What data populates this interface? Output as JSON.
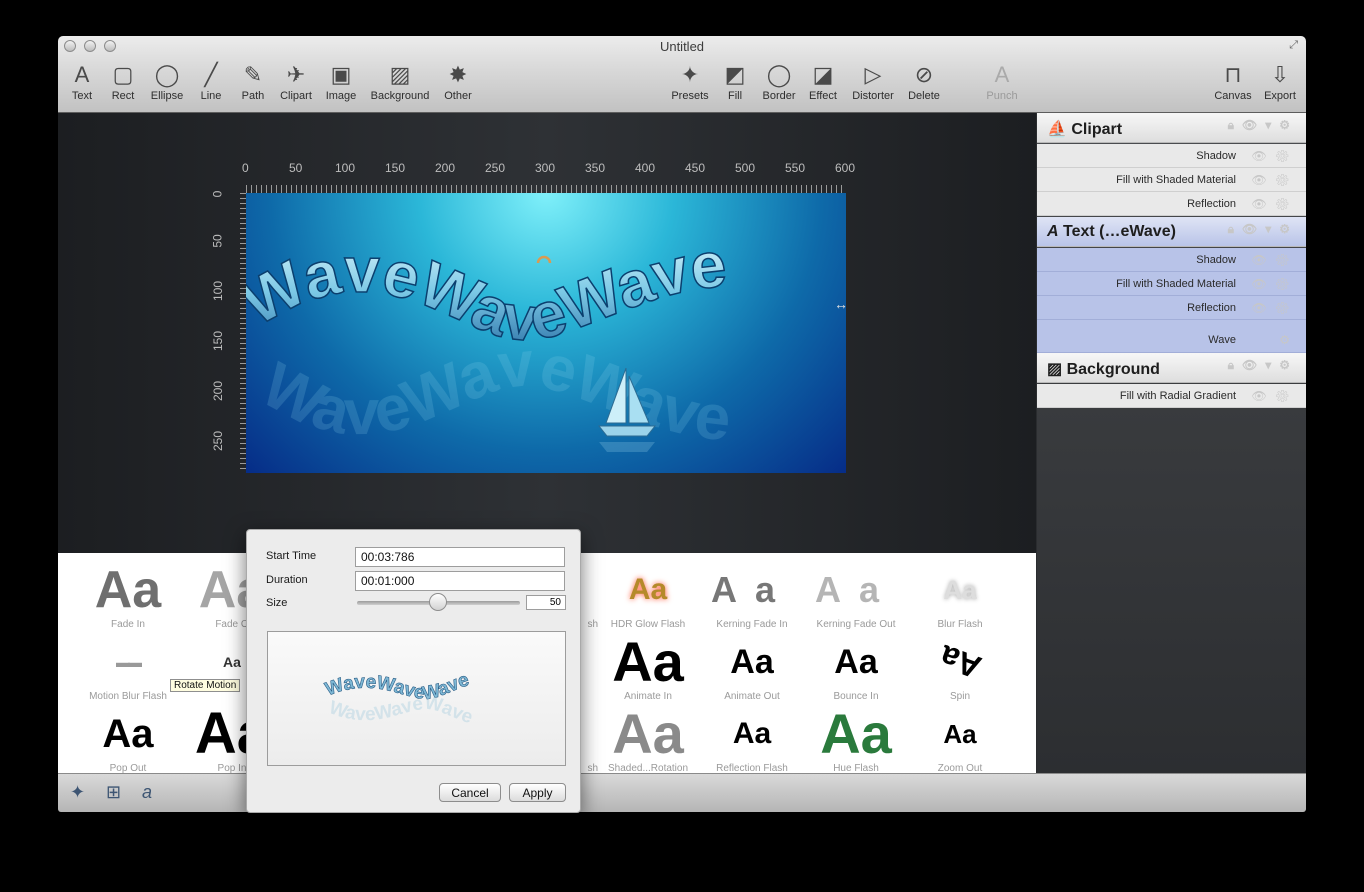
{
  "window": {
    "title": "Untitled"
  },
  "toolbar": {
    "left": [
      {
        "label": "Text",
        "icon": "A"
      },
      {
        "label": "Rect",
        "icon": "▢"
      },
      {
        "label": "Ellipse",
        "icon": "◯"
      },
      {
        "label": "Line",
        "icon": "╱"
      },
      {
        "label": "Path",
        "icon": "✎"
      },
      {
        "label": "Clipart",
        "icon": "✈"
      },
      {
        "label": "Image",
        "icon": "▣"
      },
      {
        "label": "Background",
        "icon": "▨"
      },
      {
        "label": "Other",
        "icon": "✸"
      }
    ],
    "middle": [
      {
        "label": "Presets",
        "icon": "✦"
      },
      {
        "label": "Fill",
        "icon": "◩"
      },
      {
        "label": "Border",
        "icon": "◯"
      },
      {
        "label": "Effect",
        "icon": "◪"
      },
      {
        "label": "Distorter",
        "icon": "▷"
      },
      {
        "label": "Delete",
        "icon": "⊘"
      }
    ],
    "punch": {
      "label": "Punch",
      "icon": "A"
    },
    "right": [
      {
        "label": "Canvas",
        "icon": "⊓"
      },
      {
        "label": "Export",
        "icon": "⇩"
      }
    ]
  },
  "ruler": {
    "x": [
      "0",
      "50",
      "100",
      "150",
      "200",
      "250",
      "300",
      "350",
      "400",
      "450",
      "500",
      "550",
      "600"
    ],
    "y": [
      "0",
      "50",
      "100",
      "150",
      "200",
      "250"
    ]
  },
  "artwork": {
    "text": "WaveWaveWave"
  },
  "layers": [
    {
      "name": "Clipart",
      "icon": "⛵",
      "selected": false,
      "effects": [
        "Shadow",
        "Fill with Shaded Material",
        "Reflection"
      ]
    },
    {
      "name": "Text (…eWave)",
      "icon": "A",
      "selected": true,
      "effects": [
        "Shadow",
        "Fill with Shaded Material",
        "Reflection",
        "Wave"
      ]
    },
    {
      "name": "Background",
      "icon": "▨",
      "selected": false,
      "effects": [
        "Fill with Radial Gradient"
      ]
    }
  ],
  "presets": {
    "sample": "Aa",
    "visible": [
      {
        "label": "Fade In"
      },
      {
        "label": "Fade O"
      },
      {
        "label": "HDR Glow Flash"
      },
      {
        "label": "Kerning Fade In"
      },
      {
        "label": "Kerning Fade Out"
      },
      {
        "label": "Blur Flash"
      },
      {
        "label": "Motion Blur Flash"
      },
      {
        "label": "Animate In"
      },
      {
        "label": "Animate Out"
      },
      {
        "label": "Bounce In"
      },
      {
        "label": "Spin"
      },
      {
        "label": "Pop Out"
      },
      {
        "label": "Pop In"
      },
      {
        "label": "Shaded...Rotation"
      },
      {
        "label": "Reflection Flash"
      },
      {
        "label": "Hue Flash"
      },
      {
        "label": "Zoom Out"
      }
    ],
    "partial_labels": [
      "sh",
      "sh"
    ],
    "tooltip": "Rotate Motion"
  },
  "popover": {
    "start_time_label": "Start Time",
    "start_time": "00:03:786",
    "duration_label": "Duration",
    "duration": "00:01:000",
    "size_label": "Size",
    "size": 50,
    "size_value": "50",
    "preview_text": "WaveWaveWave",
    "cancel_label": "Cancel",
    "apply_label": "Apply"
  },
  "colors": {
    "selection": "#b8c3e8",
    "art_center": "#7ff0fa",
    "art_edge": "#062c87"
  }
}
